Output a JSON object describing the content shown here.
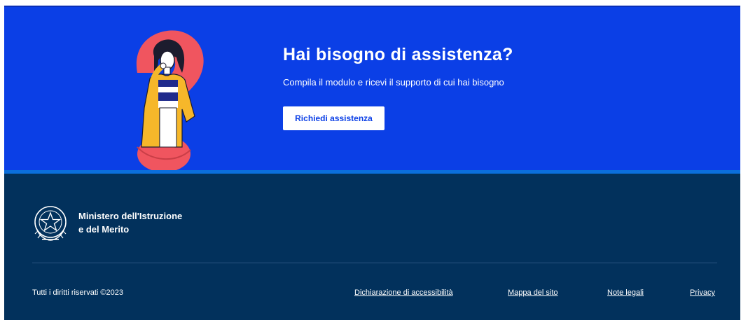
{
  "hero": {
    "title": "Hai bisogno di assistenza?",
    "subtitle": "Compila il modulo e ricevi il supporto di cui hai bisogno",
    "cta_label": "Richiedi assistenza",
    "illustration": "person-thinking-question-mark-illustration"
  },
  "footer": {
    "logo_icon": "italian-republic-emblem-icon",
    "ministry_line1": "Ministero dell'Istruzione",
    "ministry_line2": "e del Merito",
    "copyright": "Tutti i diritti riservati ©2023",
    "links": {
      "accessibility": "Dichiarazione di accessibilità",
      "sitemap": "Mappa del sito",
      "legal": "Note legali",
      "privacy": "Privacy"
    }
  },
  "colors": {
    "hero_background": "#0b3fe6",
    "footer_background": "#02315c",
    "question_mark": "#f0555f",
    "accent_stripe": "#0b6fdc"
  }
}
